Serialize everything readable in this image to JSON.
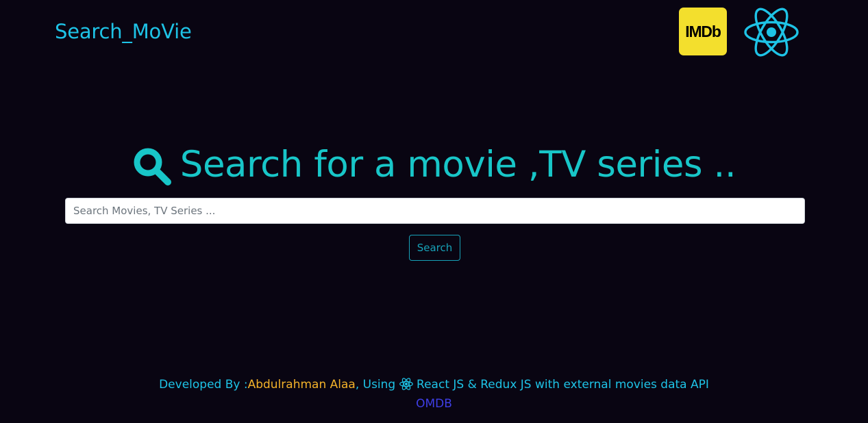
{
  "header": {
    "brand": "Search_MoVie",
    "imdb_logo_text": "IMDb",
    "react_logo_icon": "react-atom-icon"
  },
  "hero": {
    "icon": "magnifier-icon",
    "title": "Search for a movie ,TV series .."
  },
  "search": {
    "placeholder": "Search Movies, TV Series ...",
    "value": "",
    "button_label": "Search"
  },
  "footer": {
    "prefix": "Developed By :",
    "author": "Abdulrahman Alaa",
    "using_text": ", Using ",
    "tech_text": " React JS & Redux JS with external movies data API",
    "api_link": "OMDB"
  },
  "colors": {
    "background": "#090512",
    "accent_cyan": "#1ec3e6",
    "hero_teal": "#18c6c8",
    "author_orange": "#f3b22a",
    "link_blue": "#3f3fe6",
    "imdb_yellow": "#f3df2d"
  }
}
